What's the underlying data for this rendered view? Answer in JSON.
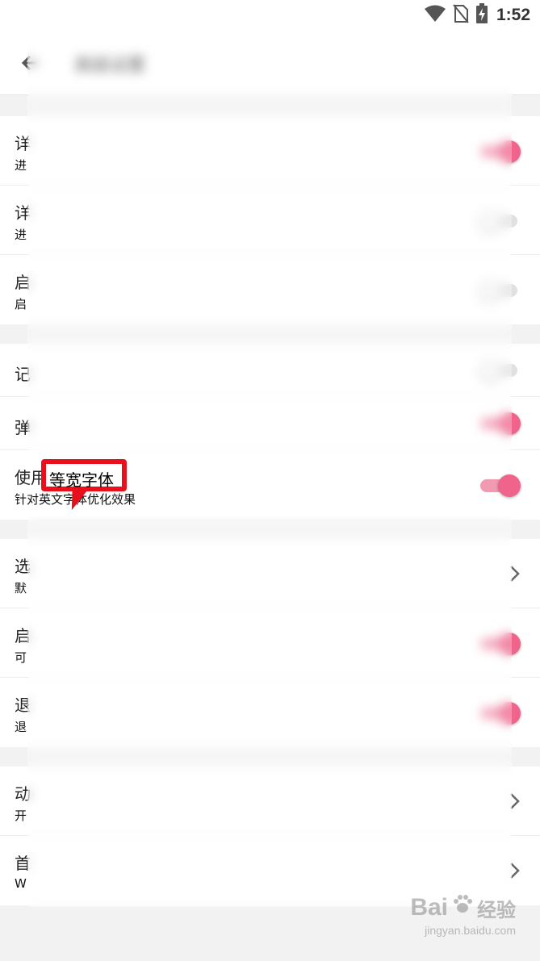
{
  "status_bar": {
    "time": "1:52"
  },
  "app_bar": {
    "title": "高级设置"
  },
  "sections": [
    {
      "rows": [
        {
          "title": "详",
          "summary": "进",
          "control": "toggle",
          "checked": true
        },
        {
          "title": "详",
          "summary": "进",
          "control": "toggle",
          "checked": false
        },
        {
          "title": "启",
          "summary": "启",
          "control": "toggle",
          "checked": false
        }
      ]
    },
    {
      "rows": [
        {
          "title": "记",
          "summary": "",
          "control": "toggle",
          "checked": false
        },
        {
          "title": "弹",
          "summary": "",
          "control": "toggle",
          "checked": true
        },
        {
          "title": "使用等宽字体",
          "summary": "针对英文字体优化效果",
          "control": "toggle",
          "checked": true
        }
      ]
    },
    {
      "rows": [
        {
          "title": "选",
          "summary": "默",
          "control": "chevron"
        },
        {
          "title": "启",
          "summary": "可",
          "control": "toggle",
          "checked": true
        },
        {
          "title": "退",
          "summary": "退",
          "control": "toggle",
          "checked": true
        }
      ]
    },
    {
      "rows": [
        {
          "title": "动",
          "summary": "开",
          "control": "chevron"
        },
        {
          "title": "首",
          "summary": "W",
          "control": "chevron"
        }
      ]
    }
  ],
  "callout": {
    "text": "等宽字体"
  },
  "watermark": {
    "brand": "Bai",
    "brand_cn": "经验",
    "url": "jingyan.baidu.com"
  },
  "colors": {
    "accent": "#f0638b",
    "callout_border": "#e8101c"
  }
}
